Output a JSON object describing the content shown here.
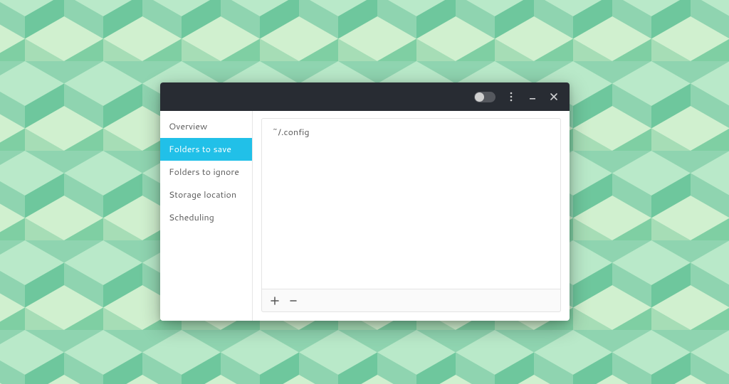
{
  "colors": {
    "titlebar": "#282c33",
    "accent": "#21c0e8"
  },
  "titlebar": {
    "toggle_on": false
  },
  "sidebar": {
    "items": [
      {
        "label": "Overview",
        "selected": false
      },
      {
        "label": "Folders to save",
        "selected": true
      },
      {
        "label": "Folders to ignore",
        "selected": false
      },
      {
        "label": "Storage location",
        "selected": false
      },
      {
        "label": "Scheduling",
        "selected": false
      }
    ]
  },
  "folders": {
    "items": [
      {
        "path": "~/.config"
      }
    ]
  }
}
